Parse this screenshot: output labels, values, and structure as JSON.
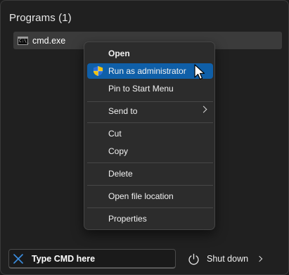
{
  "results": {
    "section_title": "Programs (1)",
    "program": {
      "label": "cmd.exe",
      "icon_text": "C:\\_",
      "icon": "cmd-icon"
    }
  },
  "context_menu": {
    "items": [
      {
        "label": "Open",
        "bold": true
      },
      {
        "label": "Run as administrator",
        "icon": "uac-shield-icon",
        "highlighted": true
      },
      {
        "label": "Pin to Start Menu"
      },
      {
        "label": "Send to",
        "submenu": true
      },
      {
        "label": "Cut"
      },
      {
        "label": "Copy"
      },
      {
        "label": "Delete"
      },
      {
        "label": "Open file location"
      },
      {
        "label": "Properties"
      }
    ]
  },
  "search": {
    "value": "Type CMD here",
    "clear_icon": "close-icon"
  },
  "power": {
    "label": "Shut down",
    "icon": "power-icon",
    "arrow_icon": "chevron-right-icon"
  },
  "colors": {
    "highlight": "#0f5fa8",
    "background": "#202020",
    "menu_bg": "#2c2c2c",
    "accent_blue": "#1e7ad8"
  }
}
